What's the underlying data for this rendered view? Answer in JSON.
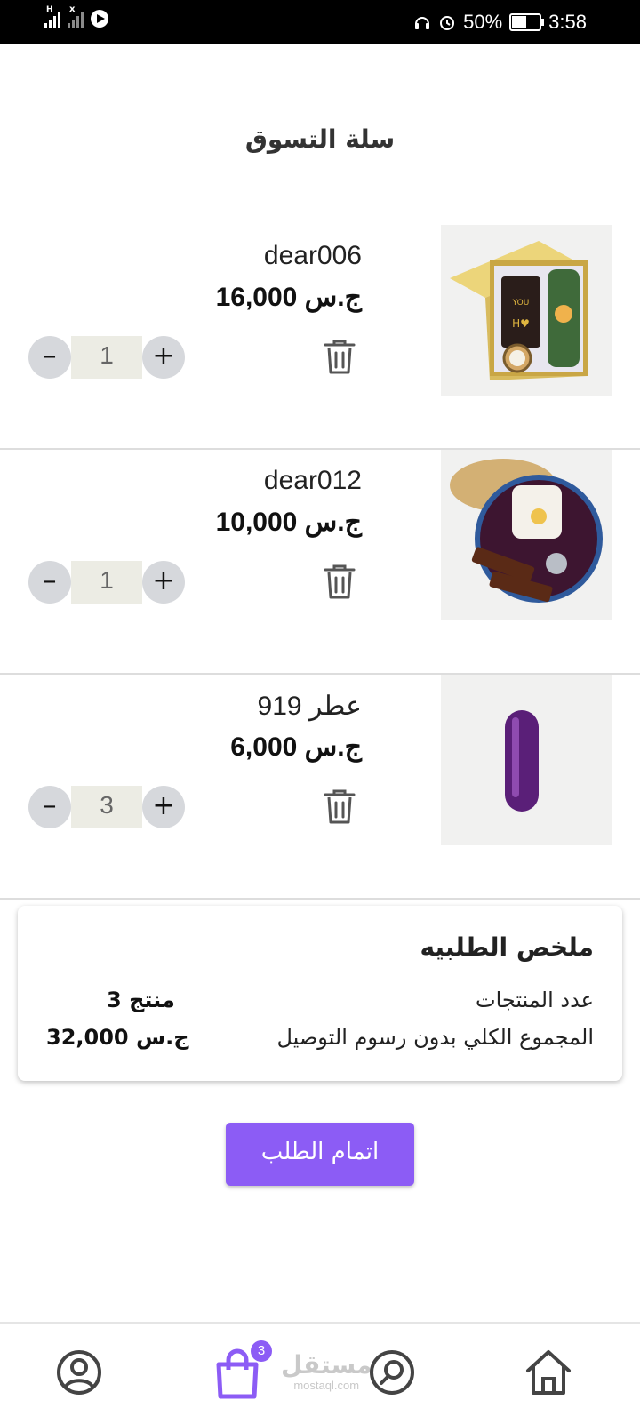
{
  "status_bar": {
    "battery": "50%",
    "time": "3:58",
    "signal_label_1": "H",
    "signal_label_2": "x"
  },
  "page_title": "سلة التسوق",
  "cart": {
    "items": [
      {
        "name": "dear006",
        "price": "16,000 ج.س",
        "quantity": "1",
        "image_icon": "gift-box-image"
      },
      {
        "name": "dear012",
        "price": "10,000 ج.س",
        "quantity": "1",
        "image_icon": "gift-box-image"
      },
      {
        "name": "عطر 919",
        "price": "6,000 ج.س",
        "quantity": "3",
        "image_icon": "perfume-image"
      }
    ],
    "minus_label": "–",
    "plus_label": "+"
  },
  "summary": {
    "title": "ملخص الطلبيه",
    "product_count_label": "عدد المنتجات",
    "product_count_value": "3 منتج",
    "total_label": "المجموع الكلي بدون رسوم التوصيل",
    "total_value": "32,000 ج.س"
  },
  "checkout_button": "اتمام الطلب",
  "bottom_nav": {
    "cart_badge": "3",
    "icons": [
      "profile-icon",
      "cart-icon",
      "search-icon",
      "home-icon"
    ],
    "active_color": "#8c5cf5"
  },
  "watermark": {
    "arabic": "مستقل",
    "latin": "mostaql.com"
  }
}
